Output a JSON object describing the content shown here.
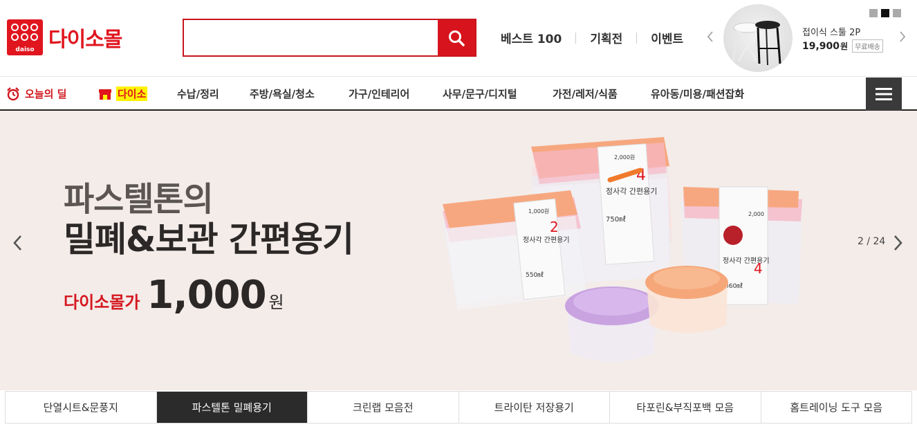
{
  "logo": {
    "sub_text": "daiso",
    "text": "다이소몰"
  },
  "search": {
    "placeholder": "",
    "button_icon": "search-icon"
  },
  "top_links": [
    "베스트 100",
    "기획전",
    "이벤트"
  ],
  "promo": {
    "title": "접이식 스툴 2P",
    "price": "19,900",
    "price_unit": "원",
    "badge": "무료배송",
    "pager_total_dots": 3,
    "pager_active_dot": 2
  },
  "nav": {
    "deal": "오늘의 딜",
    "daiso": "다이소",
    "items": [
      "수납/정리",
      "주방/욕실/청소",
      "가구/인테리어",
      "사무/문구/디지털",
      "가전/레저/식품",
      "유아동/미용/패션잡화"
    ],
    "menu_icon": "hamburger-icon"
  },
  "banner": {
    "line1": "파스텔톤의",
    "line2": "밀폐&보관 간편용기",
    "price_label": "다이소몰가",
    "price_value": "1,000",
    "price_unit": "원",
    "counter": "2 / 24",
    "product_labels": {
      "rect_small_name": "정사각 간편용기",
      "rect_small_count": "2",
      "rect_small_volume": "550㎖",
      "rect_small_price": "1,000원",
      "rect_big_name": "정사각 간편용기",
      "rect_big_count": "4",
      "rect_big_volume": "750㎖",
      "rect_big_price": "2,000원",
      "right_name": "정사각 간편용기",
      "right_count": "4",
      "right_volume": "360㎖",
      "right_price": "2,000"
    }
  },
  "tabs": [
    {
      "label": "단열시트&문풍지",
      "active": false
    },
    {
      "label": "파스텔톤 밀폐용기",
      "active": true
    },
    {
      "label": "크린랩 모음전",
      "active": false
    },
    {
      "label": "트라이탄 저장용기",
      "active": false
    },
    {
      "label": "타포린&부직포백 모음",
      "active": false
    },
    {
      "label": "홈트레이닝 도구 모음",
      "active": false
    }
  ],
  "colors": {
    "brand_red": "#e0151e",
    "nav_highlight": "#fff200",
    "banner_bg": "#f3ece9",
    "active_tab": "#2b2b2b"
  }
}
